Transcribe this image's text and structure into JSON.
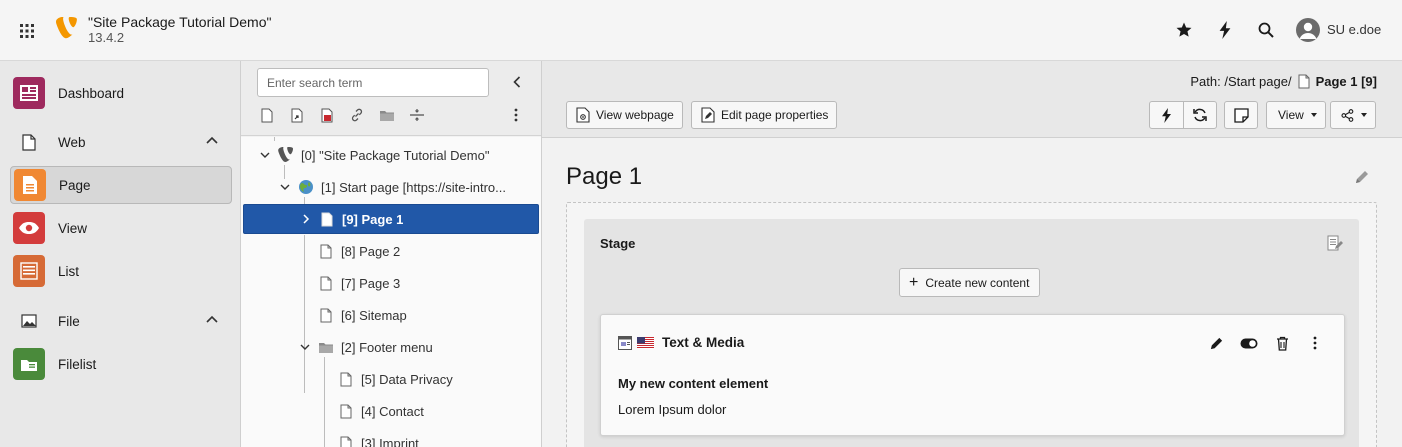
{
  "topbar": {
    "site_title": "\"Site Package Tutorial Demo\"",
    "version": "13.4.2",
    "user_name": "SU e.doe"
  },
  "modules": {
    "dashboard": "Dashboard",
    "web_group": "Web",
    "page": "Page",
    "view": "View",
    "list": "List",
    "file_group": "File",
    "filelist": "Filelist"
  },
  "tree": {
    "search_placeholder": "Enter search term",
    "nodes": [
      {
        "label": "[0] \"Site Package Tutorial Demo\""
      },
      {
        "label": "[1] Start page [https://site-intro..."
      },
      {
        "label": "[9] Page 1"
      },
      {
        "label": "[8] Page 2"
      },
      {
        "label": "[7] Page 3"
      },
      {
        "label": "[6] Sitemap"
      },
      {
        "label": "[2] Footer menu"
      },
      {
        "label": "[5] Data Privacy"
      },
      {
        "label": "[4] Contact"
      },
      {
        "label": "[3] Imprint"
      }
    ]
  },
  "docheader": {
    "path_prefix": "Path: /Start page/",
    "path_title": "Page 1 [9]",
    "view_webpage": "View webpage",
    "edit_page_properties": "Edit page properties",
    "view_dropdown": "View"
  },
  "main": {
    "page_title": "Page 1",
    "colpos_title": "Stage",
    "create_new_content": "Create new content",
    "content_element": {
      "type_label": "Text & Media",
      "header": "My new content element",
      "body": "Lorem Ipsum dolor"
    }
  },
  "colors": {
    "selected_node": "#2158a8",
    "dashboard_icon": "#9e2a5e",
    "page_icon": "#f08833",
    "view_icon": "#d33c3c",
    "list_icon": "#d66a36",
    "filelist_icon": "#4a8a3b",
    "typo3_orange": "#f49700"
  }
}
